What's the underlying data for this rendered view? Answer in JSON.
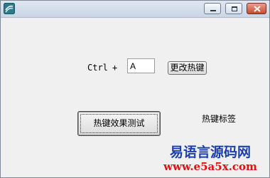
{
  "window": {
    "icon": "app-icon",
    "controls": {
      "minimize_icon": "minimize-icon",
      "maximize_icon": "maximize-icon",
      "close_icon": "close-icon"
    }
  },
  "hotkey": {
    "modifier_label": "Ctrl",
    "plus_label": "+",
    "key_value": "A",
    "change_button_label": "更改热键"
  },
  "test": {
    "button_label": "热键效果测试",
    "status_label": "热键标签"
  },
  "watermark": {
    "site_name": "易语言源码网",
    "url": "www.e5a5x.com"
  },
  "colors": {
    "watermark_name": "#1d3fa8",
    "watermark_url": "#e01010"
  }
}
